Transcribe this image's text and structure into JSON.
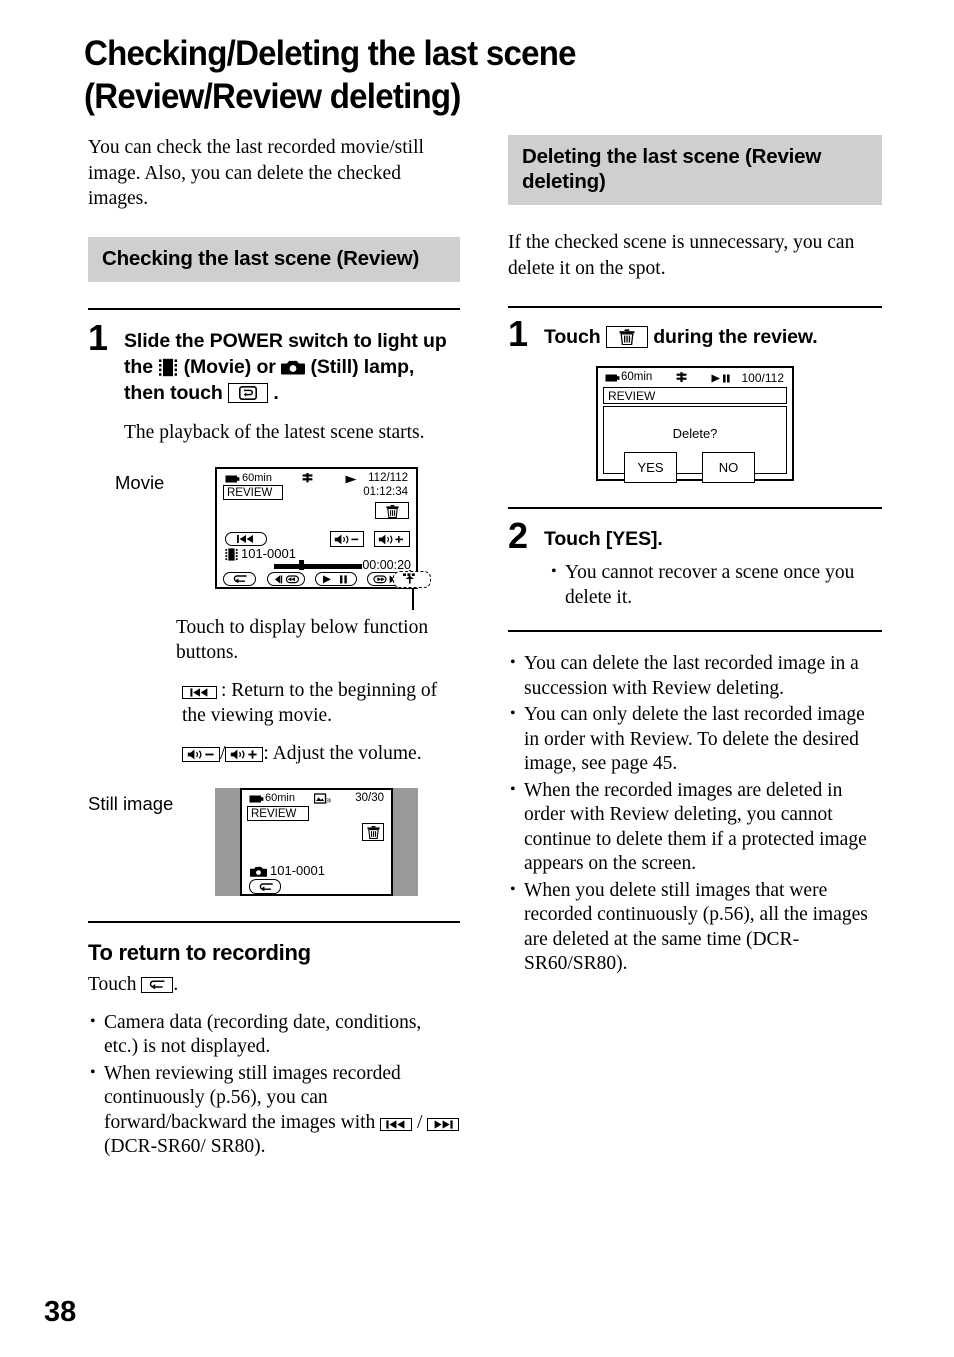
{
  "page": {
    "number": "38"
  },
  "title": {
    "line1": "Checking/Deleting the last scene",
    "line2": "(Review/Review deleting)"
  },
  "left": {
    "intro": "You can check the last recorded movie/still image. Also, you can delete the checked images.",
    "section_head": "Checking the last scene (Review)",
    "step1": {
      "number": "1",
      "text_a": "Slide the POWER switch to light up the",
      "text_b": "(Movie) or",
      "text_c": "(Still) lamp,",
      "text_d": "then touch",
      "text_e": ".",
      "sub": "The playback of the latest scene starts."
    },
    "movie_label": "Movie",
    "movie_screen": {
      "battery": "60min",
      "review": "REVIEW",
      "counter": "112/112",
      "timecode": "01:12:34",
      "file_number": "101-0001",
      "elapsed": "00:00:20"
    },
    "touch_caption": "Touch to display below function buttons.",
    "legend_rewind": ": Return to the beginning of the viewing movie.",
    "legend_volume_sep": "/",
    "legend_volume": ": Adjust the volume.",
    "still_label": "Still image",
    "still_screen": {
      "battery": "60min",
      "review": "REVIEW",
      "counter": "30/30",
      "file_number": "101-0001"
    },
    "return_head": "To return to recording",
    "return_touch_pre": "Touch",
    "return_touch_post": ".",
    "bullets": [
      "Camera data (recording date, conditions, etc.) is not displayed."
    ],
    "bullet_forward": {
      "pre": "When reviewing still images recorded continuously (p.56), you can forward/backward the images with",
      "sep": "/",
      "post": "(DCR-SR60/ SR80)."
    }
  },
  "right": {
    "section_head": "Deleting the last scene (Review deleting)",
    "intro": "If the checked scene is unnecessary, you can delete it on the spot.",
    "step1": {
      "number": "1",
      "text_a": "Touch",
      "text_b": "during the review."
    },
    "delete_screen": {
      "battery": "60min",
      "review": "REVIEW",
      "counter": "100/112",
      "prompt": "Delete?",
      "yes": "YES",
      "no": "NO"
    },
    "step2": {
      "number": "2",
      "text": "Touch [YES].",
      "bullet": "You cannot recover a scene once you delete it."
    },
    "bullets": [
      "You can delete the last recorded image in a succession with Review deleting.",
      "You can only delete the last recorded image in order with Review. To delete the desired image, see page 45.",
      "When the recorded images are deleted in order with Review deleting, you cannot continue to delete them if a protected image appears on the screen.",
      "When you delete still images that were recorded continuously (p.56), all the images are deleted at the same time (DCR-SR60/SR80)."
    ]
  },
  "icons": {
    "movie_lamp": "movie-film-icon",
    "still_lamp": "still-camera-icon",
    "review_button": "review-loop-icon",
    "trash": "trash-can-icon",
    "rewind_begin": "rewind-to-beginning-icon",
    "volume_down": "volume-down-icon",
    "volume_up": "volume-up-icon",
    "return": "return-arrow-icon",
    "prev_image": "previous-image-icon",
    "next_image": "next-image-icon",
    "play": "play-icon",
    "pause": "pause-icon",
    "display_buttons": "display-function-buttons-icon"
  },
  "colors": {
    "section_head_bg": "#cfcfcf",
    "screen_border": "#000000",
    "lcd_surround": "#9a9a9a"
  }
}
